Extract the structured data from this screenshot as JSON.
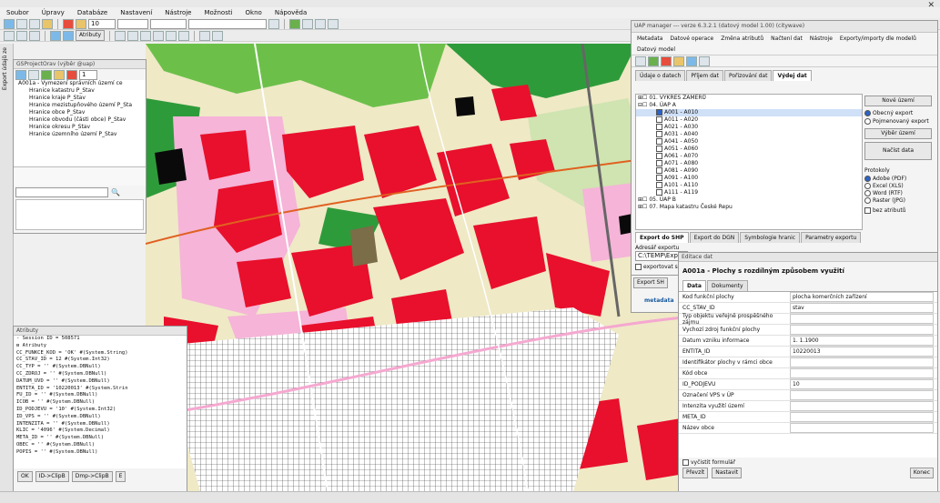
{
  "menu": [
    "Soubor",
    "Úpravy",
    "Databáze",
    "Nastavení",
    "Nástroje",
    "Možnosti",
    "Okno",
    "Nápověda"
  ],
  "toolbar": {
    "scale_value": "10",
    "attributes_label": "Atributy"
  },
  "side_tab_label": "Export údajů ze",
  "project_window": {
    "title": "GSProjectOrav (výběr @uap)",
    "page_field": "1",
    "tree_items": [
      "A001a - Vymezení správních území ce",
      "Hranice katastru P_Stav",
      "Hranice kraje P_Stav",
      "Hranice mezistupňového území P_Sta",
      "Hranice obce P_Stav",
      "Hranice obvodu (části obce) P_Stav",
      "Hranice okresu P_Stav",
      "Hranice územního území P_Stav"
    ]
  },
  "attributes_window": {
    "title": "Atributy",
    "rows": [
      "- Session ID        = 508571",
      "⊟ Atributy",
      "   CC_FUNKCE_KOD  = 'OK' #(System.String)",
      "   CC_STAV_ID     = 12 #(System.Int32)",
      "   CC_TYP         = '' #(System.DBNull)",
      "   CC_ZDROJ       = '' #(System.DBNull)",
      "   DATUM_UVD      = '' #(System.DBNull)",
      "   ENTITA_ID      = '10220013' #(System.Strin",
      "   FU_ID          = '' #(System.DBNull)",
      "   ICOB           = '' #(System.DBNull)",
      "   ID_PODJEVU     = '10' #(System.Int32)",
      "   ID_VPS         = '' #(System.DBNull)",
      "   INTENZITA      = '' #(System.DBNull)",
      "   KLIC           = '4096' #(System.Decimal)",
      "   META_ID        = '' #(System.DBNull)",
      "   OBEC           = '' #(System.DBNull)",
      "   POPIS          = '' #(System.DBNull)"
    ],
    "buttons": [
      "OK",
      "ID->ClipB",
      "Dmp->ClipB",
      "E"
    ]
  },
  "uap_manager": {
    "title": "UAP manager  ---  verze 6.3.2.1 (datový model 1.00) (citywave)",
    "menu": [
      "Metadata",
      "Datové operace",
      "Změna atributů",
      "Načtení dat",
      "Nástroje",
      "Exporty/importy dle modelů"
    ],
    "menu_row2": "Datový model",
    "tabs": [
      "Údaje o datech",
      "Příjem dat",
      "Pořizování dat",
      "Výdej dat"
    ],
    "tree": [
      "⊞☐ 01. VÝKRES ZÁMĚRŮ",
      "⊟☐ 04. ÚAP A",
      "A001 - A010",
      "A011 - A020",
      "A021 - A030",
      "A031 - A040",
      "A041 - A050",
      "A051 - A060",
      "A061 - A070",
      "A071 - A080",
      "A081 - A090",
      "A091 - A100",
      "A101 - A110",
      "A111 - A119",
      "⊞☐ 05. ÚAP B",
      "⊞☐ 07. Mapa katastru České Repu"
    ],
    "right_buttons": [
      "Nové území",
      "Výběr území",
      "Načíst data"
    ],
    "export_radios": [
      "Obecný export",
      "Pojmenovaný export"
    ],
    "protokoly_label": "Protokoly",
    "protokoly": [
      "Adobe (PDF)",
      "Excel (XLS)",
      "Word (RTF)",
      "Raster (JPG)"
    ],
    "bez_atributu": "bez atributů",
    "export_tabs": [
      "Export do SHP",
      "Export do DGN",
      "Symbologie hranic",
      "Parametry exportu"
    ],
    "export_label": "Adresář exportu",
    "export_path": "C:\\TEMP\\Export\\",
    "export_check": "exportovat sy",
    "export_btn": "Export SH",
    "metadata_label": "metadata"
  },
  "editor": {
    "title": "Editace dat",
    "header": "A001a - Plochy s rozdílným způsobem využití",
    "tabs": [
      "Data",
      "Dokumenty"
    ],
    "fields": [
      {
        "label": "Kod funkční plochy",
        "value": "plocha komerčních zařízení"
      },
      {
        "label": "CC_STAV_ID",
        "value": "stav"
      },
      {
        "label": "Typ objektu veřejně prospěšného zájmu",
        "value": ""
      },
      {
        "label": "Vychozí zdroj funkční plochy",
        "value": ""
      },
      {
        "label": "Datum vzniku informace",
        "value": "1. 1.1900"
      },
      {
        "label": "ENTITA_ID",
        "value": "10220013"
      },
      {
        "label": "Identifikátor plochy v rámci obce",
        "value": ""
      },
      {
        "label": "Kód obce",
        "value": ""
      },
      {
        "label": "ID_PODJEVU",
        "value": "10"
      },
      {
        "label": "Označení VPS v ÚP",
        "value": ""
      },
      {
        "label": "Intenzita využití území",
        "value": ""
      },
      {
        "label": "META_ID",
        "value": ""
      },
      {
        "label": "Název obce",
        "value": ""
      }
    ],
    "check_label": "vyčistit formulář",
    "buttons": [
      "Převzít",
      "Nastavit"
    ],
    "close_btn": "Konec"
  },
  "colors": {
    "map_red": "#e8102c",
    "map_pink": "#f5b4d8",
    "map_green": "#2e9b3a",
    "map_lime": "#6cc04a",
    "map_pale": "#f2eeb0",
    "map_black": "#0a0a0a",
    "accent_blue": "#2b63c6"
  }
}
